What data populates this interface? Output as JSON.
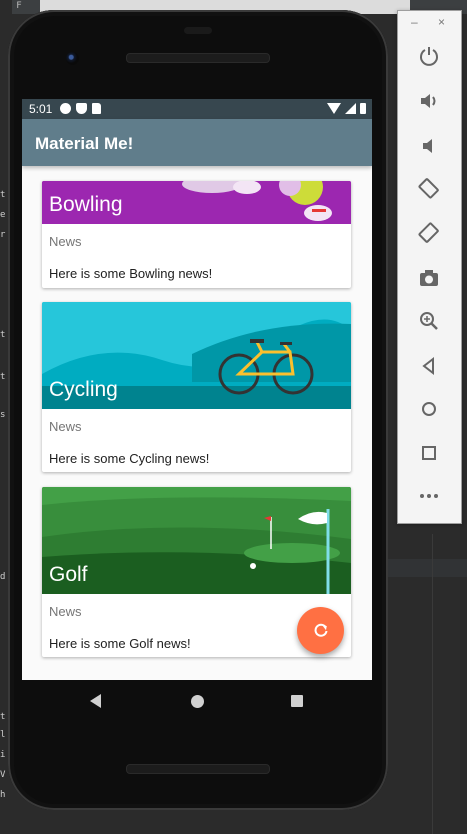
{
  "ide": {
    "top_text": "1: F",
    "left_chars": [
      "t",
      "e",
      "r",
      "t",
      "t",
      "s",
      "d",
      "t",
      "l",
      "i",
      "V",
      "h"
    ]
  },
  "status_bar": {
    "time": "5:01"
  },
  "app_bar": {
    "title": "Material Me!"
  },
  "cards": [
    {
      "title": "Bowling",
      "category": "News",
      "body": "Here is some Bowling news!",
      "image_color": "#9c27b0"
    },
    {
      "title": "Cycling",
      "category": "News",
      "body": "Here is some Cycling news!",
      "image_color": "#26c6da"
    },
    {
      "title": "Golf",
      "category": "News",
      "body": "Here is some Golf news!",
      "image_color": "#2e7d32"
    }
  ],
  "fab": {
    "icon": "refresh-icon",
    "color": "#ff7043"
  },
  "nav_bar": {
    "icons": [
      "back-icon",
      "home-icon",
      "recents-icon"
    ]
  },
  "emulator_toolbar": {
    "window_controls": [
      "–",
      "×"
    ],
    "tools": [
      "power-icon",
      "volume-up-icon",
      "volume-down-icon",
      "rotate-left-icon",
      "rotate-right-icon",
      "camera-icon",
      "zoom-icon",
      "back-icon",
      "home-icon",
      "overview-icon",
      "more-icon"
    ]
  }
}
